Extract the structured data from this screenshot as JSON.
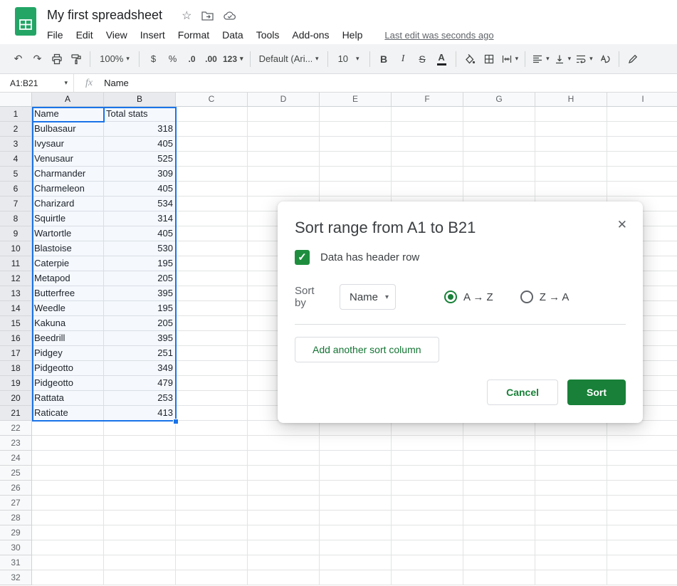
{
  "colors": {
    "accent_green": "#188038",
    "checkbox_green": "#1e8e3e",
    "logo_green": "#23a566",
    "selection_blue": "#1a73e8"
  },
  "header": {
    "title": "My first spreadsheet",
    "menus": [
      "File",
      "Edit",
      "View",
      "Insert",
      "Format",
      "Data",
      "Tools",
      "Add-ons",
      "Help"
    ],
    "last_edit": "Last edit was seconds ago"
  },
  "toolbar": {
    "zoom": "100%",
    "currency": "$",
    "percent": "%",
    "decrease_decimal": ".0",
    "increase_decimal": ".00",
    "more_formats": "123",
    "font": "Default (Ari...",
    "font_size": "10",
    "bold": "B",
    "italic": "I",
    "strikethrough": "S",
    "text_color": "A"
  },
  "formula_bar": {
    "name_box": "A1:B21",
    "fx": "fx",
    "value": "Name"
  },
  "grid": {
    "columns": [
      "A",
      "B",
      "C",
      "D",
      "E",
      "F",
      "G",
      "H",
      "I"
    ],
    "visible_rows": 32,
    "selected_rows": 21,
    "selected_columns": [
      "A",
      "B"
    ],
    "cells": [
      [
        "Name",
        "Total stats"
      ],
      [
        "Bulbasaur",
        318
      ],
      [
        "Ivysaur",
        405
      ],
      [
        "Venusaur",
        525
      ],
      [
        "Charmander",
        309
      ],
      [
        "Charmeleon",
        405
      ],
      [
        "Charizard",
        534
      ],
      [
        "Squirtle",
        314
      ],
      [
        "Wartortle",
        405
      ],
      [
        "Blastoise",
        530
      ],
      [
        "Caterpie",
        195
      ],
      [
        "Metapod",
        205
      ],
      [
        "Butterfree",
        395
      ],
      [
        "Weedle",
        195
      ],
      [
        "Kakuna",
        205
      ],
      [
        "Beedrill",
        395
      ],
      [
        "Pidgey",
        251
      ],
      [
        "Pidgeotto",
        349
      ],
      [
        "Pidgeotto",
        479
      ],
      [
        "Rattata",
        253
      ],
      [
        "Raticate",
        413
      ]
    ]
  },
  "dialog": {
    "title": "Sort range from A1 to B21",
    "close": "✕",
    "header_checkbox_label": "Data has header row",
    "sort_by_label": "Sort by",
    "sort_by_value": "Name",
    "radio_az": "A → Z",
    "radio_za": "Z → A",
    "add_sort_column_label": "Add another sort column",
    "cancel_label": "Cancel",
    "sort_label": "Sort"
  },
  "icons": {
    "undo": "↶",
    "redo": "↷",
    "star": "☆",
    "dropdown": "▾",
    "check": "✓"
  }
}
